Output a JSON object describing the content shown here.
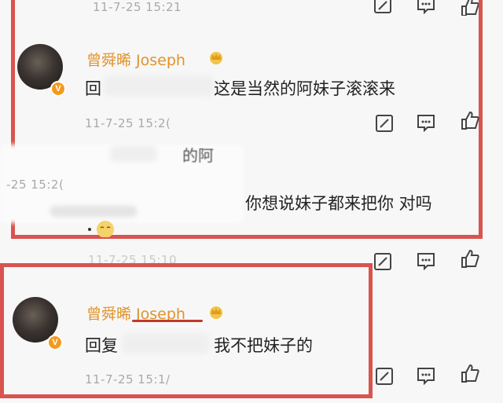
{
  "top_row": {
    "timestamp": "11-7-25 15:21"
  },
  "comment1": {
    "name": "曾舜晞 Joseph",
    "reply_prefix": "回",
    "text": "这是当然的阿妹子滚滚来",
    "timestamp": "11-7-25 15:2("
  },
  "obscured": {
    "fragment": "的阿",
    "timestamp": "-25 15:2(",
    "text": "你想说妹子都来把你 对吗"
  },
  "middle_row": {
    "timestamp": "11-7-25 15:10"
  },
  "comment2": {
    "name": "曾舜晞 Joseph",
    "reply_prefix": "回复",
    "text": "我不把妹子的",
    "timestamp": "11-7-25 15:1/"
  },
  "colors": {
    "highlight_box": "#d9534f",
    "verified_badge": "#f39a1e",
    "username": "#e0932a"
  }
}
